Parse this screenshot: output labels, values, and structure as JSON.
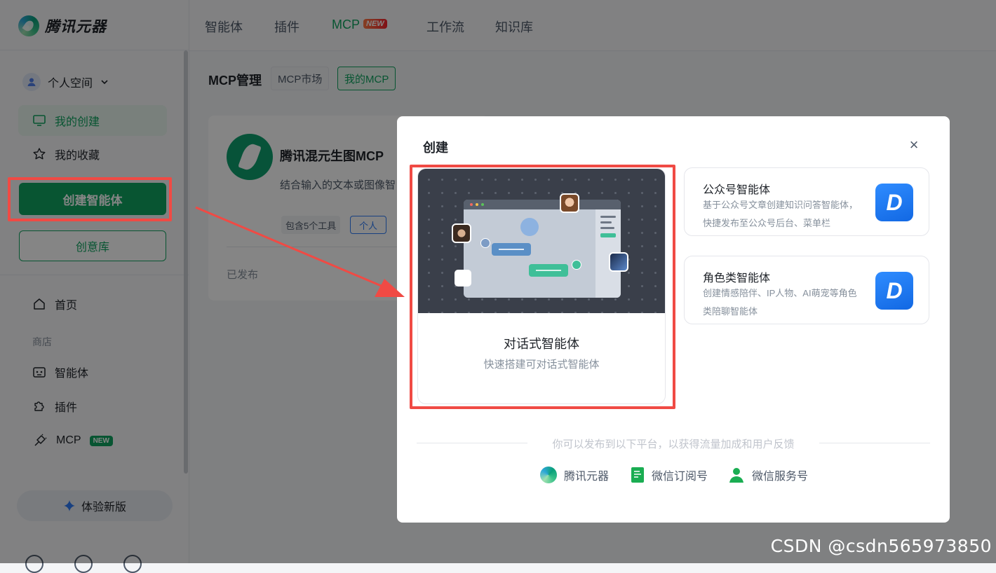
{
  "brand": {
    "name": "腾讯元器"
  },
  "topnav": {
    "tabs": [
      "智能体",
      "插件",
      "MCP",
      "工作流",
      "知识库"
    ],
    "new_badge": "NEW",
    "active_tab": "MCP"
  },
  "sidebar": {
    "space_label": "个人空间",
    "my_creations": "我的创建",
    "my_favorites": "我的收藏",
    "create_button": "创建智能体",
    "idea_button": "创意库",
    "home": "首页",
    "store_section": "商店",
    "store_items": [
      "智能体",
      "插件",
      "MCP"
    ],
    "mcp_new_badge": "NEW",
    "try_new_version": "体验新版"
  },
  "main": {
    "title": "MCP管理",
    "filters": [
      "MCP市场",
      "我的MCP"
    ],
    "card": {
      "name": "腾讯混元生图MCP",
      "description": "结合输入的文本或图像智",
      "tool_count": "包含5个工具",
      "owner_tag": "个人",
      "status": "已发布"
    }
  },
  "modal": {
    "title": "创建",
    "close_icon": "×",
    "primary_option": {
      "name": "对话式智能体",
      "description": "快速搭建可对话式智能体"
    },
    "options": [
      {
        "name": "公众号智能体",
        "description": "基于公众号文章创建知识问答智能体， 快捷发布至公众号后台、菜单栏",
        "icon_letter": "D"
      },
      {
        "name": "角色类智能体",
        "description": "创建情感陪伴、IP人物、AI萌宠等角色类陪聊智能体",
        "icon_letter": "D"
      }
    ],
    "publish_hint": "你可以发布到以下平台，以获得流量加成和用户反馈",
    "platforms": [
      "腾讯元器",
      "微信订阅号",
      "微信服务号"
    ]
  },
  "watermark": "CSDN @csdn565973850",
  "colors": {
    "brand_green": "#11a460",
    "annotation_red": "#f04a44",
    "option_icon_blue": "#1f7bf2"
  }
}
